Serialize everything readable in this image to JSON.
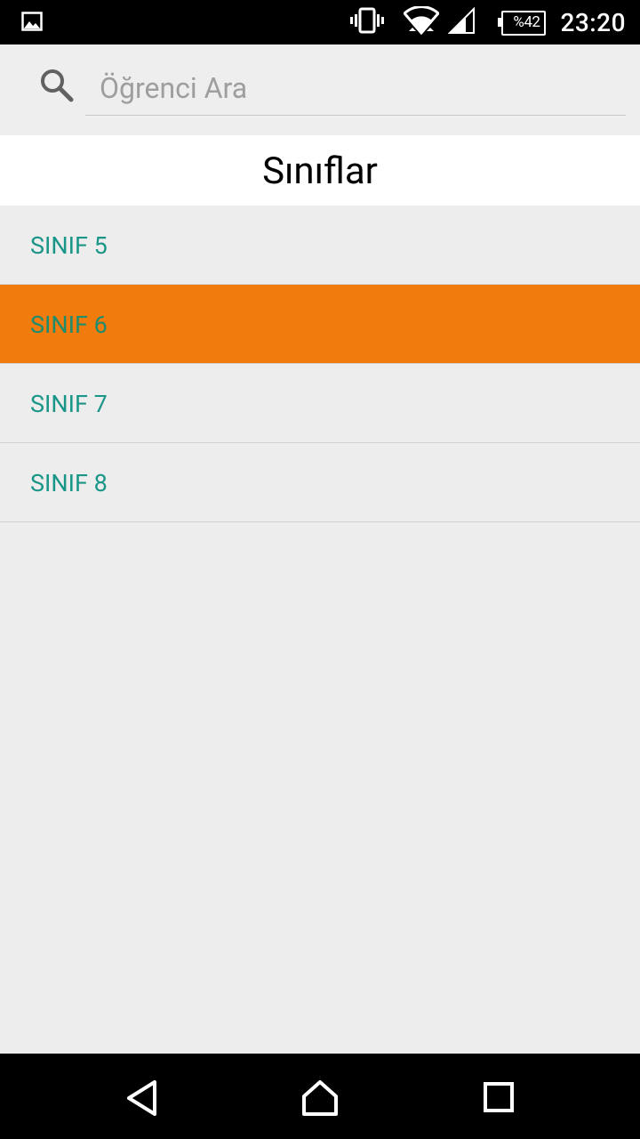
{
  "status_bar": {
    "left_icon": "image-notification-icon",
    "vibrate_icon": "vibrate-icon",
    "wifi_icon": "wifi-icon",
    "signal_icon": "cell-signal-icon",
    "battery_icon": "battery-icon",
    "battery_percent": "%42",
    "time": "23:20"
  },
  "search": {
    "icon": "search-icon",
    "placeholder": "Öğrenci Ara",
    "value": ""
  },
  "title": "Sınıflar",
  "classes": [
    {
      "label": "SINIF 5",
      "selected": false
    },
    {
      "label": "SINIF 6",
      "selected": true
    },
    {
      "label": "SINIF 7",
      "selected": false
    },
    {
      "label": "SINIF 8",
      "selected": false
    }
  ],
  "nav_bar": {
    "back_icon": "back-triangle-icon",
    "home_icon": "home-icon",
    "recents_icon": "recents-square-icon"
  },
  "colors": {
    "accent_text": "#1a9688",
    "selected_background": "#f27b0e",
    "list_background": "#ededed",
    "title_background": "#ffffff"
  }
}
